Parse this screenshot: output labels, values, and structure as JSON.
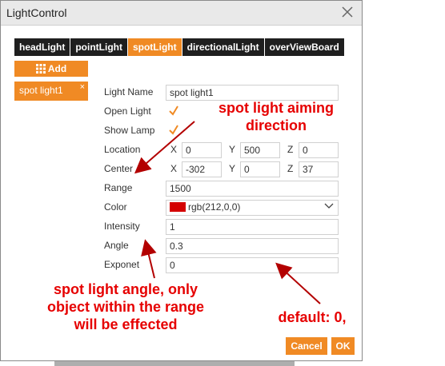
{
  "window": {
    "title": "LightControl"
  },
  "tabs": [
    {
      "label": "headLight"
    },
    {
      "label": "pointLight"
    },
    {
      "label": "spotLight"
    },
    {
      "label": "directionalLight"
    },
    {
      "label": "overViewBoard"
    }
  ],
  "sidebar": {
    "add_label": "Add",
    "items": [
      {
        "label": "spot light1",
        "remove_glyph": "×"
      }
    ]
  },
  "form": {
    "light_name": {
      "label": "Light Name",
      "value": "spot light1"
    },
    "open_light": {
      "label": "Open Light",
      "checked": true
    },
    "show_lamp": {
      "label": "Show Lamp",
      "checked": true
    },
    "location": {
      "label": "Location",
      "x": "0",
      "y": "500",
      "z": "0"
    },
    "center": {
      "label": "Center",
      "x": "-302",
      "y": "0",
      "z": "37"
    },
    "axis_labels": {
      "x": "X",
      "y": "Y",
      "z": "Z"
    },
    "range": {
      "label": "Range",
      "value": "1500"
    },
    "color": {
      "label": "Color",
      "value": "rgb(212,0,0)",
      "swatch": "#d40000"
    },
    "intensity": {
      "label": "Intensity",
      "value": "1"
    },
    "angle": {
      "label": "Angle",
      "value": "0.3"
    },
    "exponent": {
      "label": "Exponet",
      "value": "0"
    }
  },
  "buttons": {
    "cancel": "Cancel",
    "ok": "OK"
  },
  "annotations": {
    "aiming_line1": "spot light aiming",
    "aiming_line2": "direction",
    "angle_line1": "spot light angle, only",
    "angle_line2": "object within the range",
    "angle_line3": "will be effected",
    "default_text": "default: 0,"
  },
  "colors": {
    "accent": "#f08a24",
    "tab_bg": "#1f1f1f",
    "annotation": "#e60000"
  }
}
